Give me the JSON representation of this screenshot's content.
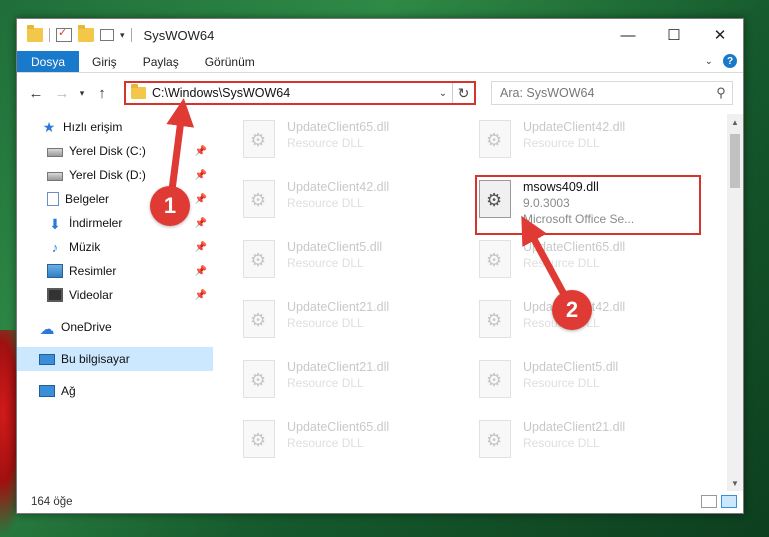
{
  "window": {
    "title": "SysWOW64",
    "controls": {
      "minimize": "—",
      "maximize": "☐",
      "close": "✕"
    }
  },
  "ribbon": {
    "tabs": [
      "Dosya",
      "Giriş",
      "Paylaş",
      "Görünüm"
    ],
    "help": "?"
  },
  "address_bar": {
    "path": "C:\\Windows\\SysWOW64"
  },
  "search": {
    "placeholder": "Ara: SysWOW64"
  },
  "sidebar": {
    "items": [
      {
        "label": "Hızlı erişim",
        "icon": "star-icon",
        "pinned": false
      },
      {
        "label": "Yerel Disk (C:)",
        "icon": "disk-icon",
        "pinned": true
      },
      {
        "label": "Yerel Disk (D:)",
        "icon": "disk-icon",
        "pinned": true
      },
      {
        "label": "Belgeler",
        "icon": "documents-icon",
        "pinned": true
      },
      {
        "label": "İndirmeler",
        "icon": "downloads-icon",
        "pinned": true
      },
      {
        "label": "Müzik",
        "icon": "music-icon",
        "pinned": true
      },
      {
        "label": "Resimler",
        "icon": "pictures-icon",
        "pinned": true
      },
      {
        "label": "Videolar",
        "icon": "videos-icon",
        "pinned": true
      },
      {
        "label": "OneDrive",
        "icon": "onedrive-icon",
        "pinned": false
      },
      {
        "label": "Bu bilgisayar",
        "icon": "this-pc-icon",
        "pinned": false,
        "selected": true
      },
      {
        "label": "Ağ",
        "icon": "network-icon",
        "pinned": false
      }
    ]
  },
  "files": {
    "left_column": [
      {
        "name": "UpdateClient65.dll",
        "type": "Resource DLL"
      },
      {
        "name": "UpdateClient42.dll",
        "type": "Resource DLL"
      },
      {
        "name": "UpdateClient5.dll",
        "type": "Resource DLL"
      },
      {
        "name": "UpdateClient21.dll",
        "type": "Resource DLL"
      },
      {
        "name": "UpdateClient21.dll",
        "type": "Resource DLL"
      },
      {
        "name": "UpdateClient65.dll",
        "type": "Resource DLL"
      }
    ],
    "right_column": [
      {
        "name": "UpdateClient42.dll",
        "type": "Resource DLL"
      },
      {
        "name": "msows409.dll",
        "version": "9.0.3003",
        "type": "Microsoft Office Se...",
        "highlighted": true
      },
      {
        "name": "UpdateClient65.dll",
        "type": "Resource DLL"
      },
      {
        "name": "UpdateClient42.dll",
        "type": "Resource DLL"
      },
      {
        "name": "UpdateClient5.dll",
        "type": "Resource DLL"
      },
      {
        "name": "UpdateClient21.dll",
        "type": "Resource DLL"
      }
    ]
  },
  "status": {
    "item_count": "164 öğe"
  },
  "annotations": {
    "callout_1": "1",
    "callout_2": "2",
    "color": "#e03a35"
  }
}
